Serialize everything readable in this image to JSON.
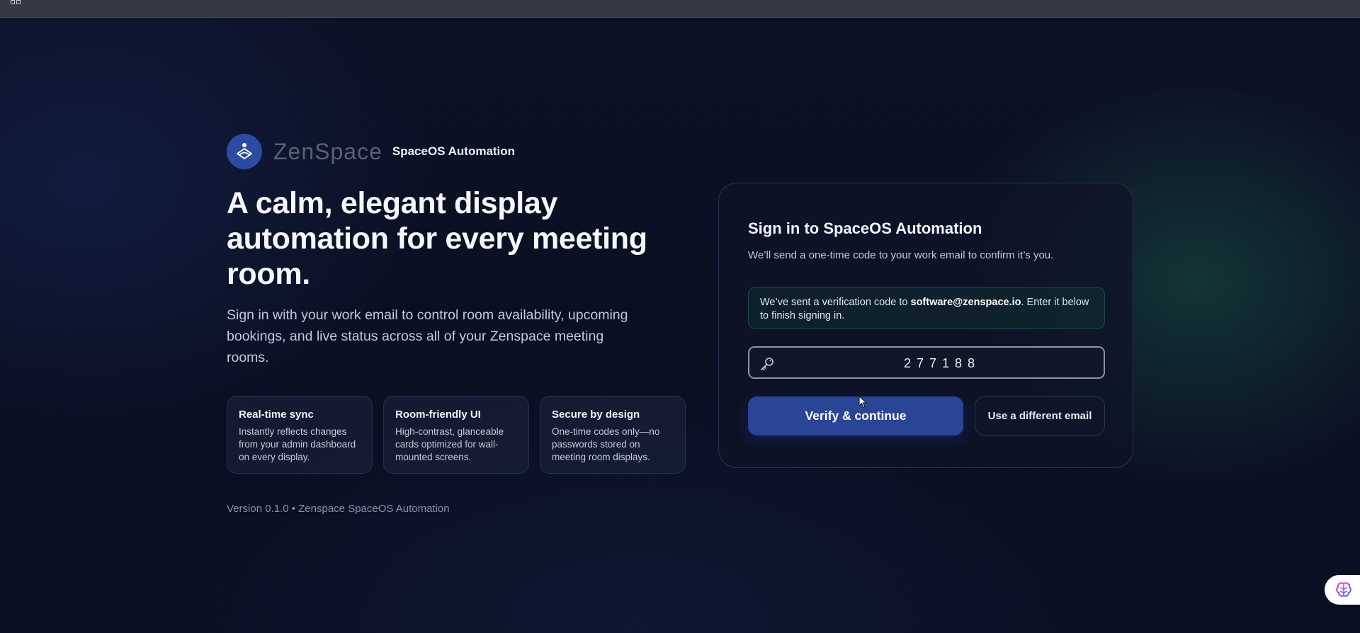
{
  "brand": {
    "wordmark": "ZenSpace",
    "product": "SpaceOS Automation"
  },
  "hero": {
    "headline": "A calm, elegant display automation for every meeting room.",
    "subcopy": "Sign in with your work email to control room availability, upcoming bookings, and live status across all of your Zenspace meeting rooms."
  },
  "features": [
    {
      "title": "Real-time sync",
      "description": "Instantly reflects changes from your admin dashboard on every display."
    },
    {
      "title": "Room-friendly UI",
      "description": "High-contrast, glanceable cards optimized for wall-mounted screens."
    },
    {
      "title": "Secure by design",
      "description": "One-time codes only—no passwords stored on meeting room displays."
    }
  ],
  "footer": {
    "version": "Version 0.1.0 • Zenspace SpaceOS Automation"
  },
  "signin": {
    "title": "Sign in to SpaceOS Automation",
    "subtitle": "We’ll send a one-time code to your work email to confirm it’s you.",
    "notice_prefix": "We’ve sent a verification code to ",
    "notice_email": "software@zenspace.io",
    "notice_suffix": ". Enter it below to finish signing in.",
    "code_value": "277188",
    "verify_label": "Verify & continue",
    "alt_label": "Use a different email"
  },
  "icons": {
    "topbar": "grid-icon",
    "logo": "zenspace-logo-icon",
    "code_field": "key-icon",
    "assistant": "brain-icon"
  },
  "colors": {
    "accent": "#2a4596",
    "logo_bg": "#2c4aa3",
    "notice_border": "#1f4d45"
  }
}
